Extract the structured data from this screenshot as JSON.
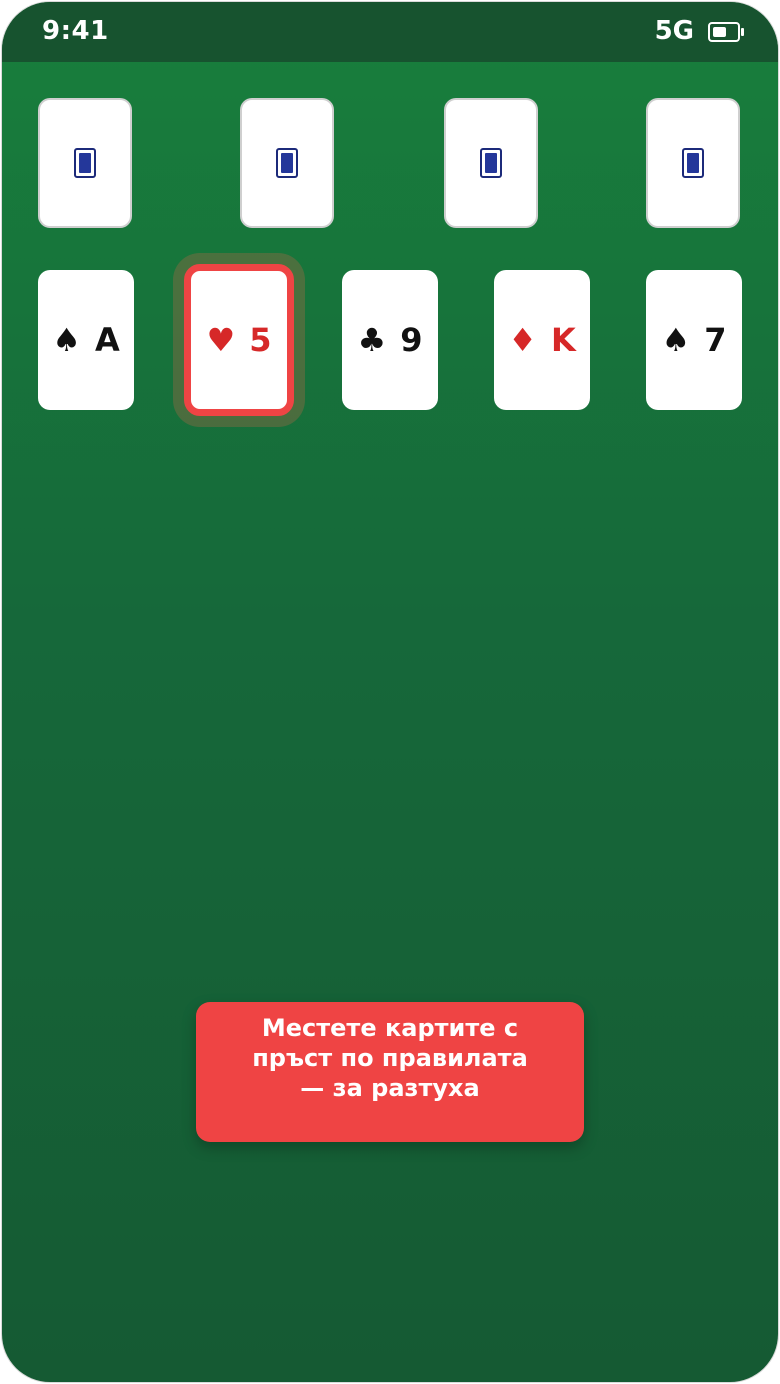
{
  "status_bar": {
    "time": "9:41",
    "network": "5G",
    "battery_icon": "battery-icon"
  },
  "stock_piles": [
    {
      "icon": "card-back-icon"
    },
    {
      "icon": "card-back-icon"
    },
    {
      "icon": "card-back-icon"
    },
    {
      "icon": "card-back-icon"
    }
  ],
  "tableau": [
    {
      "suit": "♠",
      "rank": "A",
      "color": "black"
    },
    {
      "suit": "♥",
      "rank": "5",
      "color": "red",
      "selected": true
    },
    {
      "suit": "♣",
      "rank": "9",
      "color": "black"
    },
    {
      "suit": "♦",
      "rank": "K",
      "color": "red"
    },
    {
      "suit": "♠",
      "rank": "7",
      "color": "black"
    }
  ],
  "toast": {
    "message": "Местете картите с пръст по правилата — за разтуха"
  },
  "colors": {
    "felt": "#187f3c",
    "status_bar": "#17532f",
    "red_suit": "#d62828",
    "highlight": "#ef4444",
    "card_back": "#24379a"
  }
}
